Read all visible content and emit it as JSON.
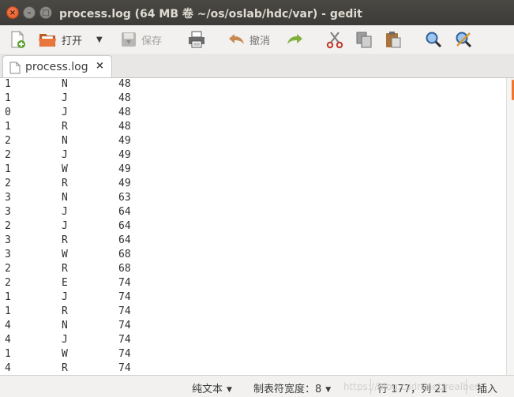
{
  "window": {
    "title": "process.log (64 MB 卷 ~/os/oslab/hdc/var) - gedit",
    "close_glyph": "×",
    "minimize_glyph": "–",
    "maximize_glyph": "□"
  },
  "toolbar": {
    "open_label": "打开",
    "save_label": "保存",
    "undo_label": "撤消"
  },
  "tab": {
    "label": "process.log",
    "close_glyph": "×"
  },
  "lines": [
    [
      "1",
      "N",
      "48"
    ],
    [
      "1",
      "J",
      "48"
    ],
    [
      "0",
      "J",
      "48"
    ],
    [
      "1",
      "R",
      "48"
    ],
    [
      "2",
      "N",
      "49"
    ],
    [
      "2",
      "J",
      "49"
    ],
    [
      "1",
      "W",
      "49"
    ],
    [
      "2",
      "R",
      "49"
    ],
    [
      "3",
      "N",
      "63"
    ],
    [
      "3",
      "J",
      "64"
    ],
    [
      "2",
      "J",
      "64"
    ],
    [
      "3",
      "R",
      "64"
    ],
    [
      "3",
      "W",
      "68"
    ],
    [
      "2",
      "R",
      "68"
    ],
    [
      "2",
      "E",
      "74"
    ],
    [
      "1",
      "J",
      "74"
    ],
    [
      "1",
      "R",
      "74"
    ],
    [
      "4",
      "N",
      "74"
    ],
    [
      "4",
      "J",
      "74"
    ],
    [
      "1",
      "W",
      "74"
    ],
    [
      "4",
      "R",
      "74"
    ]
  ],
  "statusbar": {
    "language": "纯文本",
    "tab_width": "制表符宽度：8",
    "position": "行 177，列 21",
    "mode": "插入",
    "watermark": "https://blog.csdn.net/realbery"
  },
  "colors": {
    "titlebar": "#3c3b37",
    "close_button": "#e0531e",
    "scroll_marker": "#f0752d"
  }
}
